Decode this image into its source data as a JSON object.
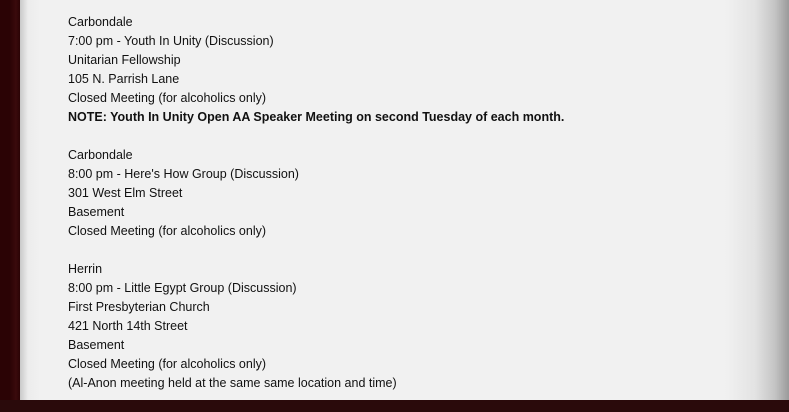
{
  "meetings": [
    {
      "city": "Carbondale",
      "time_name": "7:00 pm - Youth In Unity (Discussion)",
      "location_lines": [
        "Unitarian Fellowship",
        "105 N. Parrish Lane"
      ],
      "type": "Closed Meeting (for alcoholics only)",
      "note": "NOTE: Youth In Unity Open AA Speaker Meeting on second Tuesday of each month."
    },
    {
      "city": "Carbondale",
      "time_name": "8:00 pm - Here's How Group (Discussion)",
      "location_lines": [
        "301 West Elm Street",
        "Basement"
      ],
      "type": "Closed Meeting (for alcoholics only)"
    },
    {
      "city": "Herrin",
      "time_name": "8:00 pm - Little Egypt Group (Discussion)",
      "location_lines": [
        "First Presbyterian Church",
        "421 North 14th Street",
        "Basement"
      ],
      "type": "Closed Meeting (for alcoholics only)",
      "extra": "(Al-Anon meeting held at the same same location and time)"
    }
  ]
}
